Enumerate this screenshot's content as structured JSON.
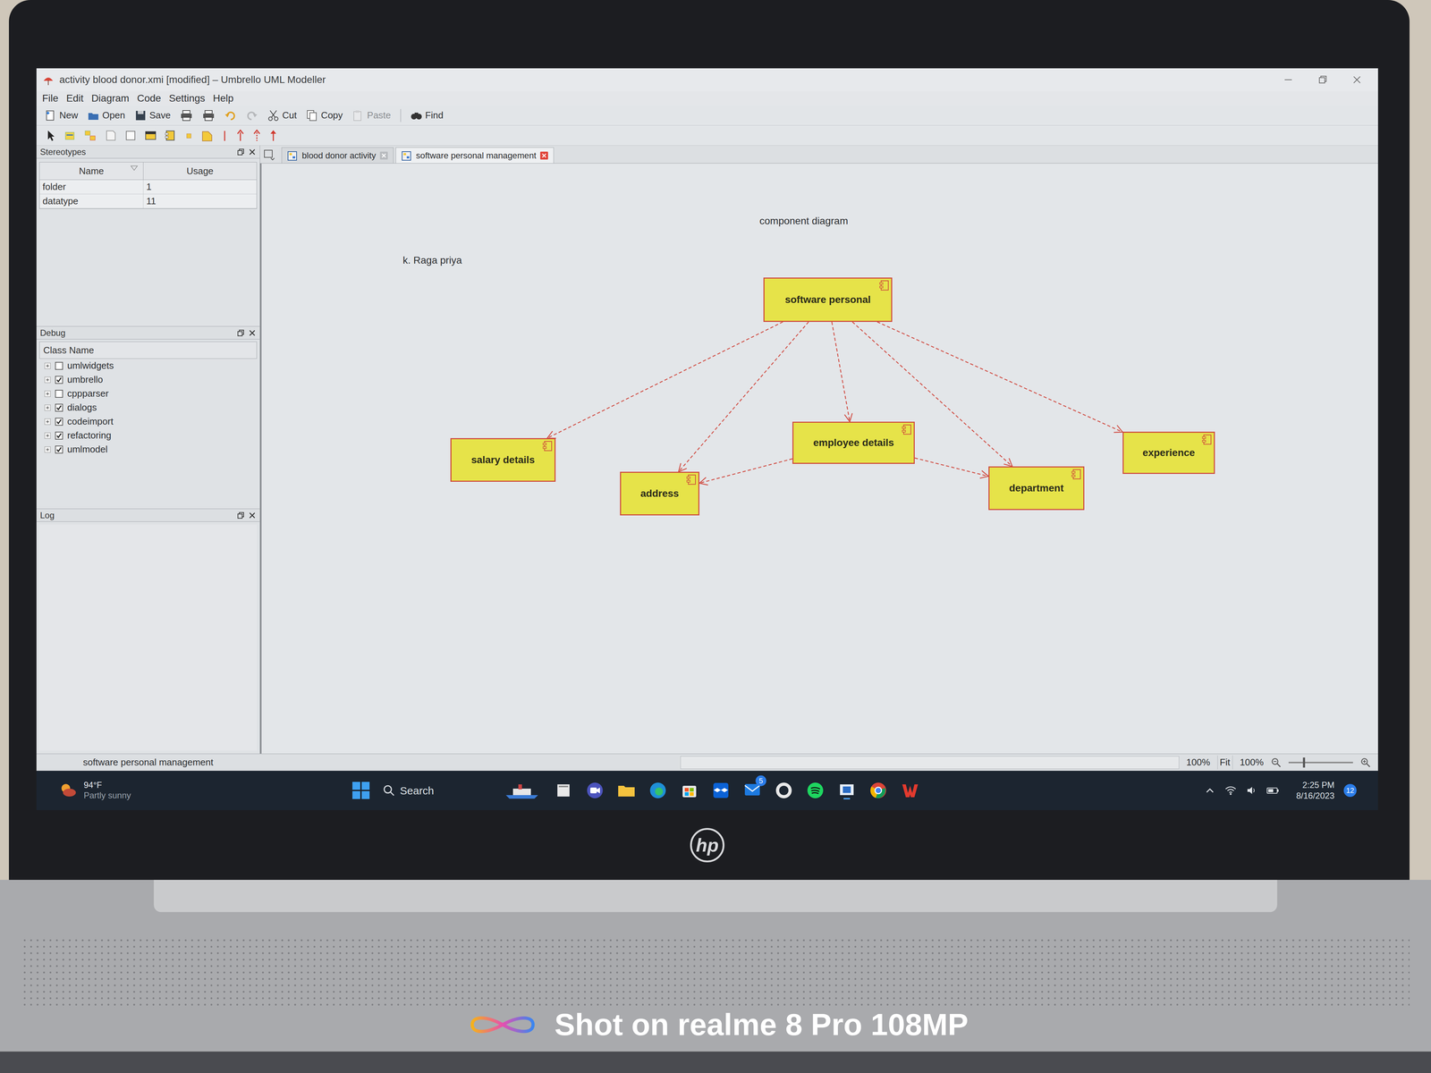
{
  "window": {
    "title": "activity blood donor.xmi [modified] – Umbrello UML Modeller"
  },
  "menu": [
    "File",
    "Edit",
    "Diagram",
    "Code",
    "Settings",
    "Help"
  ],
  "toolbar": [
    {
      "label": "New",
      "disabled": false
    },
    {
      "label": "Open",
      "disabled": false
    },
    {
      "label": "Save",
      "disabled": false
    },
    {
      "label": "Cut",
      "disabled": false
    },
    {
      "label": "Copy",
      "disabled": false
    },
    {
      "label": "Paste",
      "disabled": true
    },
    {
      "label": "Find",
      "disabled": false
    }
  ],
  "stereotypes": {
    "title": "Stereotypes",
    "columns": [
      "Name",
      "Usage"
    ],
    "rows": [
      [
        "folder",
        "1"
      ],
      [
        "datatype",
        "11"
      ]
    ]
  },
  "debug": {
    "title": "Debug",
    "column": "Class Name",
    "items": [
      {
        "label": "umlwidgets",
        "checked": false
      },
      {
        "label": "umbrello",
        "checked": true
      },
      {
        "label": "cppparser",
        "checked": false
      },
      {
        "label": "dialogs",
        "checked": true
      },
      {
        "label": "codeimport",
        "checked": true
      },
      {
        "label": "refactoring",
        "checked": true
      },
      {
        "label": "umlmodel",
        "checked": true
      }
    ]
  },
  "log": {
    "title": "Log"
  },
  "tabs": [
    {
      "label": "blood donor activity",
      "selected": false
    },
    {
      "label": "software personal management",
      "selected": true
    }
  ],
  "diagram": {
    "title": "component diagram",
    "author": "k. Raga priya",
    "nodes": [
      {
        "label": "software personal"
      },
      {
        "label": "salary details"
      },
      {
        "label": "address"
      },
      {
        "label": "employee details"
      },
      {
        "label": "department"
      },
      {
        "label": "experience"
      }
    ],
    "edges": [
      {
        "from": "software personal",
        "to": "salary details"
      },
      {
        "from": "software personal",
        "to": "address"
      },
      {
        "from": "software personal",
        "to": "employee details"
      },
      {
        "from": "software personal",
        "to": "department"
      },
      {
        "from": "software personal",
        "to": "experience"
      },
      {
        "from": "employee details",
        "to": "address"
      },
      {
        "from": "employee details",
        "to": "department"
      }
    ]
  },
  "status_bar": {
    "text": "software personal management",
    "zoom": "100%",
    "fit": "Fit",
    "zoom_actual": "100%"
  },
  "taskbar": {
    "temperature": "94°F",
    "weather": "Partly sunny",
    "search": "Search",
    "mail_badge": "5",
    "time": "2:25 PM",
    "date": "8/16/2023",
    "notifications": "12"
  },
  "laptop": {
    "logo": "hp"
  },
  "watermark": "Shot on realme 8 Pro 108MP"
}
